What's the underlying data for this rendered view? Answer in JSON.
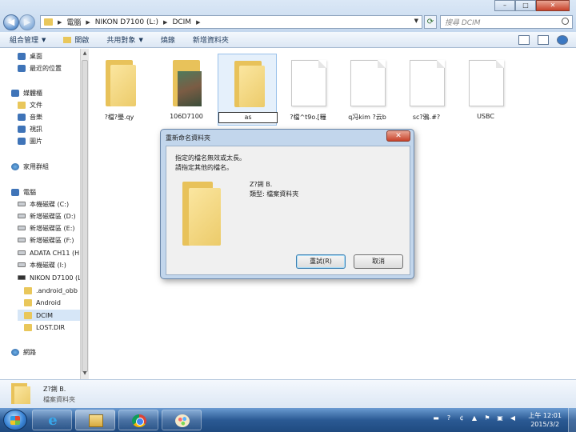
{
  "window": {
    "minimize_label": "–",
    "maximize_label": "□",
    "close_label": "✕"
  },
  "address": {
    "crumbs": [
      "電腦",
      "NIKON D7100 (L:)",
      "DCIM"
    ],
    "search_placeholder": "搜尋 DCIM"
  },
  "toolbar": {
    "organize": "組合管理",
    "open": "開啟",
    "share": "共用對象",
    "burn": "燒錄",
    "new_folder": "新增資料夾"
  },
  "nav": {
    "items": [
      {
        "label": "桌面",
        "icon": "desktop-icon"
      },
      {
        "label": "最近的位置",
        "icon": "recent-places-icon"
      },
      {
        "label": "媒體櫃",
        "icon": "libraries-icon"
      },
      {
        "label": "文件",
        "icon": "documents-icon"
      },
      {
        "label": "音樂",
        "icon": "music-icon"
      },
      {
        "label": "視訊",
        "icon": "videos-icon"
      },
      {
        "label": "圖片",
        "icon": "pictures-icon"
      },
      {
        "label": "家用群組",
        "icon": "homegroup-icon"
      },
      {
        "label": "電腦",
        "icon": "computer-icon"
      },
      {
        "label": "本機磁碟 (C:)",
        "icon": "drive-icon"
      },
      {
        "label": "新增磁碟區 (D:)",
        "icon": "drive-icon"
      },
      {
        "label": "新增磁碟區 (E:)",
        "icon": "drive-icon"
      },
      {
        "label": "新增磁碟區 (F:)",
        "icon": "drive-icon"
      },
      {
        "label": "ADATA CH11 (H",
        "icon": "drive-icon"
      },
      {
        "label": "本機磁碟 (I:)",
        "icon": "drive-icon"
      },
      {
        "label": "NIKON D7100 (L",
        "icon": "camera-drive-icon"
      },
      {
        "label": ".android_obb",
        "icon": "folder-icon"
      },
      {
        "label": "Android",
        "icon": "folder-icon"
      },
      {
        "label": "DCIM",
        "icon": "folder-icon"
      },
      {
        "label": "LOST.DIR",
        "icon": "folder-icon"
      },
      {
        "label": "網路",
        "icon": "network-icon"
      }
    ]
  },
  "files": [
    {
      "name": "?檔?璺.qy",
      "kind": "folder"
    },
    {
      "name": "106D7100",
      "kind": "photo-folder"
    },
    {
      "name": "as",
      "kind": "folder",
      "renaming": true
    },
    {
      "name": "?檔^t9o.[糧",
      "kind": "file"
    },
    {
      "name": "q冯kim ?云b",
      "kind": "file"
    },
    {
      "name": "sc?鴉.#?",
      "kind": "file"
    },
    {
      "name": "USBC",
      "kind": "file"
    }
  ],
  "dialog": {
    "title": "重新命名資料夾",
    "close_label": "✕",
    "message_line1": "指定的檔名無效或太長。",
    "message_line2": "請指定其他的檔名。",
    "folder_name": "Z?鋓 B.",
    "folder_type": "類型: 檔案資料夾",
    "retry_label": "重試(R)",
    "cancel_label": "取消"
  },
  "details": {
    "name": "Z?鋓 B.",
    "type": "檔案資料夾"
  },
  "taskbar": {
    "apps": [
      "internet-explorer",
      "windows-explorer",
      "google-chrome",
      "paint"
    ],
    "clock_time": "上午 12:01",
    "clock_date": "2015/3/2"
  },
  "colors": {
    "folder": "#e8c25a",
    "taskbar": "#2b5a94",
    "dialog_frame": "#c2d6ec",
    "close_red": "#c8432b"
  }
}
